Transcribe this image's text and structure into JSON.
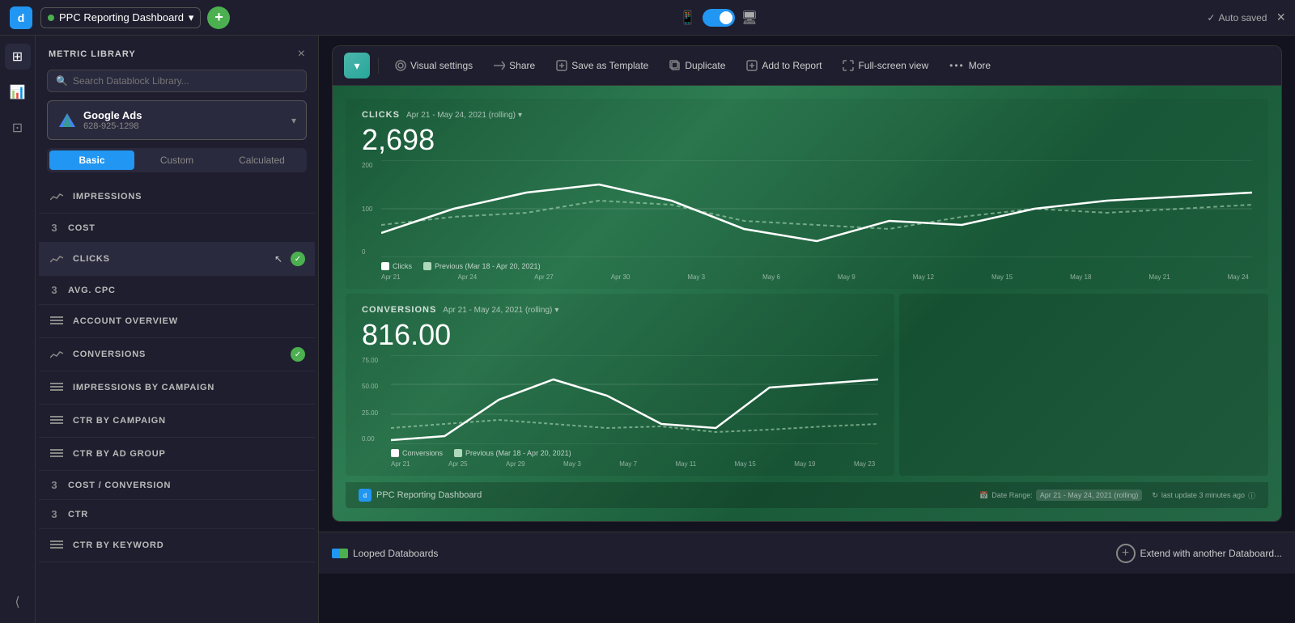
{
  "topbar": {
    "dashboard_name": "PPC Reporting Dashboard",
    "autosaved": "Auto saved",
    "close_label": "×",
    "add_label": "+"
  },
  "metric_library": {
    "title": "METRIC LIBRARY",
    "search_placeholder": "Search Datablock Library...",
    "close_label": "×",
    "data_source": {
      "name": "Google Ads",
      "id": "628-925-1298"
    },
    "tabs": [
      {
        "id": "basic",
        "label": "Basic",
        "active": true
      },
      {
        "id": "custom",
        "label": "Custom",
        "active": false
      },
      {
        "id": "calculated",
        "label": "Calculated",
        "active": false
      }
    ],
    "metrics": [
      {
        "id": "impressions",
        "label": "IMPRESSIONS",
        "type": "chart",
        "checked": false
      },
      {
        "id": "cost",
        "label": "COST",
        "type": "number",
        "checked": false
      },
      {
        "id": "clicks",
        "label": "CLICKS",
        "type": "chart",
        "checked": true
      },
      {
        "id": "avg_cpc",
        "label": "AVG. CPC",
        "type": "number",
        "checked": false
      },
      {
        "id": "account_overview",
        "label": "ACCOUNT OVERVIEW",
        "type": "table",
        "checked": false
      },
      {
        "id": "conversions",
        "label": "CONVERSIONS",
        "type": "chart",
        "checked": true
      },
      {
        "id": "impressions_by_campaign",
        "label": "IMPRESSIONS BY CAMPAIGN",
        "type": "table",
        "checked": false
      },
      {
        "id": "ctr_by_campaign",
        "label": "CTR BY CAMPAIGN",
        "type": "table",
        "checked": false
      },
      {
        "id": "ctr_by_ad_group",
        "label": "CTR BY AD GROUP",
        "type": "table",
        "checked": false
      },
      {
        "id": "cost_conversion",
        "label": "COST / CONVERSION",
        "type": "number",
        "checked": false
      },
      {
        "id": "ctr",
        "label": "CTR",
        "type": "number",
        "checked": false
      },
      {
        "id": "ctr_by_keyword",
        "label": "CTR BY KEYWORD",
        "type": "table",
        "checked": false
      }
    ]
  },
  "datablock": {
    "toolbar": {
      "visual_settings": "Visual settings",
      "share": "Share",
      "save_as_template": "Save as Template",
      "duplicate": "Duplicate",
      "add_to_report": "Add to Report",
      "full_screen_view": "Full-screen view",
      "more": "More"
    },
    "clicks_chart": {
      "metric": "CLICKS",
      "date_range": "Apr 21 - May 24, 2021 (rolling)",
      "value": "2,698",
      "y_labels": [
        "200",
        "100",
        "0"
      ],
      "x_labels": [
        "Apr 21",
        "Apr 24",
        "Apr 27",
        "Apr 30",
        "May 3",
        "May 6",
        "May 9",
        "May 12",
        "May 15",
        "May 18",
        "May 21",
        "May 24"
      ],
      "legend": [
        {
          "label": "Clicks",
          "color": "#fff"
        },
        {
          "label": "Previous (Mar 18 - Apr 20, 2021)",
          "color": "#aed9b8"
        }
      ]
    },
    "conversions_chart": {
      "metric": "CONVERSIONS",
      "date_range": "Apr 21 - May 24, 2021 (rolling)",
      "value": "816.00",
      "y_labels": [
        "75.00",
        "50.00",
        "25.00",
        "0.00"
      ],
      "x_labels": [
        "Apr 21",
        "Apr 25",
        "Apr 29",
        "May 3",
        "May 7",
        "May 11",
        "May 15",
        "May 19",
        "May 23"
      ],
      "legend": [
        {
          "label": "Conversions",
          "color": "#fff"
        },
        {
          "label": "Previous (Mar 18 - Apr 20, 2021)",
          "color": "#aed9b8"
        }
      ]
    },
    "footer": {
      "brand_name": "PPC Reporting Dashboard",
      "date_range_label": "Date Range:",
      "date_range_value": "Apr 21 - May 24, 2021 (rolling)",
      "last_update": "last update 3 minutes ago"
    }
  },
  "bottom_bar": {
    "looped_label": "Looped Databoards",
    "extend_label": "Extend with another Databoard..."
  }
}
